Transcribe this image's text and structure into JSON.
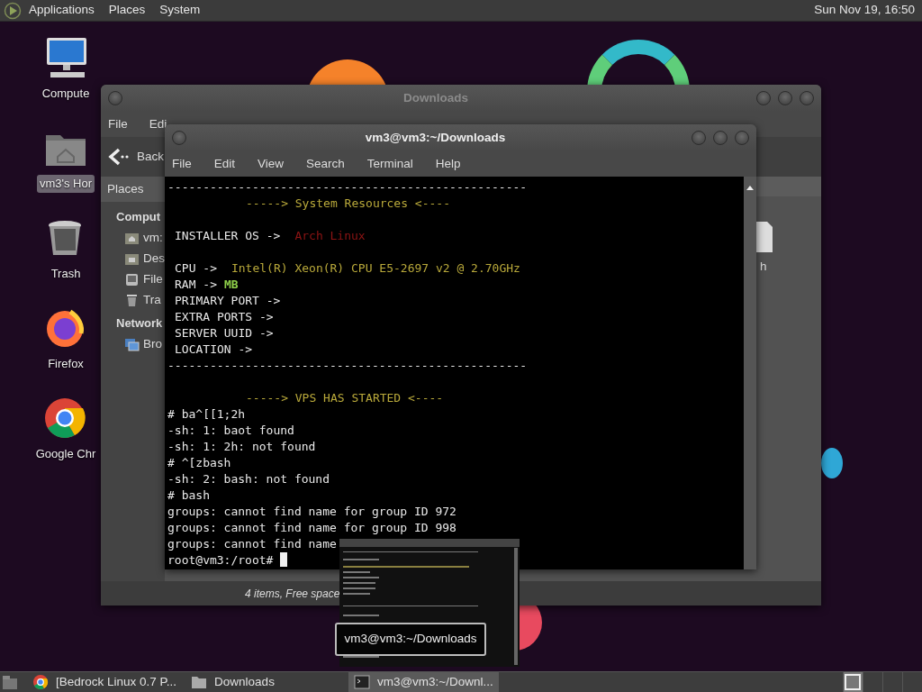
{
  "top_panel": {
    "menus": [
      "Applications",
      "Places",
      "System"
    ],
    "clock": "Sun Nov 19, 16:50"
  },
  "desktop_icons": [
    {
      "label": "Compute",
      "kind": "computer",
      "selected": false
    },
    {
      "label": "vm3's Hor",
      "kind": "home",
      "selected": true
    },
    {
      "label": "Trash",
      "kind": "trash",
      "selected": false
    },
    {
      "label": "Firefox",
      "kind": "firefox",
      "selected": false
    },
    {
      "label": "Google Chr",
      "kind": "chrome",
      "selected": false
    }
  ],
  "file_manager": {
    "title": "Downloads",
    "menus": [
      "File",
      "Edi"
    ],
    "back_button": "Back",
    "sidebar": {
      "header": "Places",
      "sections": [
        {
          "title": "Comput",
          "items": [
            {
              "label": "vm:",
              "kind": "home"
            },
            {
              "label": "Des",
              "kind": "desktop"
            },
            {
              "label": "File",
              "kind": "drive"
            },
            {
              "label": "Tra",
              "kind": "trash"
            }
          ]
        },
        {
          "title": "Network",
          "items": [
            {
              "label": "Bro",
              "kind": "network"
            }
          ]
        }
      ]
    },
    "file_label": "h",
    "status": "4 items, Free space"
  },
  "terminal": {
    "title": "vm3@vm3:~/Downloads",
    "menus": [
      "File",
      "Edit",
      "View",
      "Search",
      "Terminal",
      "Help"
    ],
    "lines": [
      {
        "kind": "rule",
        "segments": [
          {
            "text": "---------------------------------------------------"
          }
        ]
      },
      {
        "kind": "heading",
        "segments": [
          {
            "text": "-----> System Resources <----",
            "color": "#b8a83a"
          }
        ]
      },
      {
        "kind": "blank"
      },
      {
        "kind": "field",
        "segments": [
          {
            "text": "INSTALLER OS ->"
          },
          {
            "text": "Arch Linux",
            "color": "#8e1414"
          }
        ]
      },
      {
        "kind": "blank"
      },
      {
        "kind": "field",
        "segments": [
          {
            "text": "CPU ->"
          },
          {
            "text": "Intel(R) Xeon(R) CPU E5-2697 v2 @ 2.70GHz",
            "color": "#b8a83a"
          }
        ]
      },
      {
        "kind": "field",
        "segments": [
          {
            "text": "RAM ->"
          },
          {
            "text": "MB",
            "color": "#8fd14a",
            "bold": true
          }
        ]
      },
      {
        "kind": "field",
        "segments": [
          {
            "text": "PRIMARY PORT ->"
          }
        ]
      },
      {
        "kind": "field",
        "segments": [
          {
            "text": "EXTRA PORTS ->"
          }
        ]
      },
      {
        "kind": "field",
        "segments": [
          {
            "text": "SERVER UUID ->"
          }
        ]
      },
      {
        "kind": "field",
        "segments": [
          {
            "text": "LOCATION ->"
          }
        ]
      },
      {
        "kind": "rule",
        "segments": [
          {
            "text": "---------------------------------------------------"
          }
        ]
      },
      {
        "kind": "blank"
      },
      {
        "kind": "heading",
        "segments": [
          {
            "text": "-----> VPS HAS STARTED <----",
            "color": "#b8a83a"
          }
        ]
      },
      {
        "kind": "output",
        "segments": [
          {
            "text": "# ba^[[1;2h"
          }
        ]
      },
      {
        "kind": "output",
        "segments": [
          {
            "text": "-sh: 1: baot found"
          }
        ]
      },
      {
        "kind": "output",
        "segments": [
          {
            "text": "-sh: 1: 2h: not found"
          }
        ]
      },
      {
        "kind": "output",
        "segments": [
          {
            "text": "# ^[zbash"
          }
        ]
      },
      {
        "kind": "output",
        "segments": [
          {
            "text": "-sh: 2: bash: not found"
          }
        ]
      },
      {
        "kind": "output",
        "segments": [
          {
            "text": "# bash"
          }
        ]
      },
      {
        "kind": "output",
        "segments": [
          {
            "text": "groups: cannot find name for group ID 972"
          }
        ]
      },
      {
        "kind": "output",
        "segments": [
          {
            "text": "groups: cannot find name for group ID 998"
          }
        ]
      },
      {
        "kind": "output",
        "segments": [
          {
            "text": "groups: cannot find name"
          }
        ]
      },
      {
        "kind": "prompt",
        "segments": [
          {
            "text": "root@vm3:/root#"
          }
        ]
      }
    ]
  },
  "preview_tooltip": "vm3@vm3:~/Downloads",
  "taskbar": {
    "tasks": [
      {
        "label": "[Bedrock Linux 0.7 P...",
        "kind": "browser",
        "selected": false
      },
      {
        "label": "Downloads",
        "kind": "folder",
        "selected": false
      },
      {
        "label": "vm3@vm3:~/Downl...",
        "kind": "terminal",
        "selected": true
      }
    ]
  }
}
